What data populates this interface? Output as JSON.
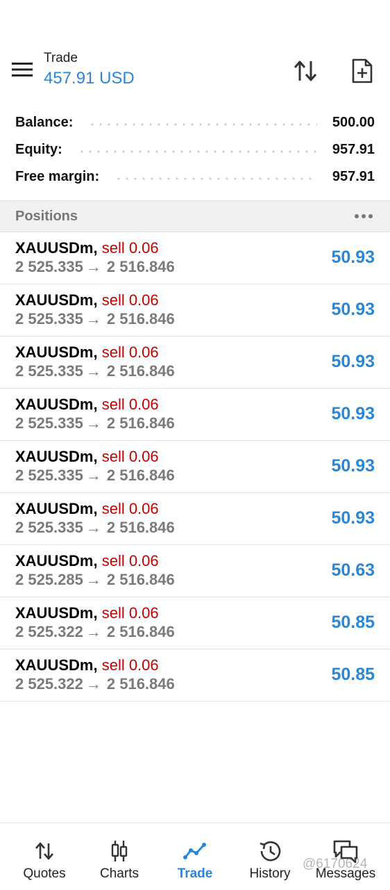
{
  "header": {
    "title": "Trade",
    "amount": "457.91 USD"
  },
  "summary": {
    "rows": [
      {
        "label": "Balance:",
        "value": "500.00"
      },
      {
        "label": "Equity:",
        "value": "957.91"
      },
      {
        "label": "Free margin:",
        "value": "957.91"
      }
    ]
  },
  "positions": {
    "title": "Positions",
    "items": [
      {
        "symbol": "XAUUSDm,",
        "side": "sell 0.06",
        "open": "2 525.335",
        "arrow": "→",
        "current": "2 516.846",
        "profit": "50.93"
      },
      {
        "symbol": "XAUUSDm,",
        "side": "sell 0.06",
        "open": "2 525.335",
        "arrow": "→",
        "current": "2 516.846",
        "profit": "50.93"
      },
      {
        "symbol": "XAUUSDm,",
        "side": "sell 0.06",
        "open": "2 525.335",
        "arrow": "→",
        "current": "2 516.846",
        "profit": "50.93"
      },
      {
        "symbol": "XAUUSDm,",
        "side": "sell 0.06",
        "open": "2 525.335",
        "arrow": "→",
        "current": "2 516.846",
        "profit": "50.93"
      },
      {
        "symbol": "XAUUSDm,",
        "side": "sell 0.06",
        "open": "2 525.335",
        "arrow": "→",
        "current": "2 516.846",
        "profit": "50.93"
      },
      {
        "symbol": "XAUUSDm,",
        "side": "sell 0.06",
        "open": "2 525.335",
        "arrow": "→",
        "current": "2 516.846",
        "profit": "50.93"
      },
      {
        "symbol": "XAUUSDm,",
        "side": "sell 0.06",
        "open": "2 525.285",
        "arrow": "→",
        "current": "2 516.846",
        "profit": "50.63"
      },
      {
        "symbol": "XAUUSDm,",
        "side": "sell 0.06",
        "open": "2 525.322",
        "arrow": "→",
        "current": "2 516.846",
        "profit": "50.85"
      },
      {
        "symbol": "XAUUSDm,",
        "side": "sell 0.06",
        "open": "2 525.322",
        "arrow": "→",
        "current": "2 516.846",
        "profit": "50.85"
      }
    ]
  },
  "nav": {
    "items": [
      {
        "label": "Quotes",
        "icon": "quotes-icon"
      },
      {
        "label": "Charts",
        "icon": "charts-icon"
      },
      {
        "label": "Trade",
        "icon": "trade-icon",
        "active": true
      },
      {
        "label": "History",
        "icon": "history-icon"
      },
      {
        "label": "Messages",
        "icon": "messages-icon"
      }
    ]
  },
  "watermark": "@6170624",
  "colors": {
    "accent": "#2a86d6",
    "sell": "#c40000",
    "muted": "#7a7a7a"
  }
}
